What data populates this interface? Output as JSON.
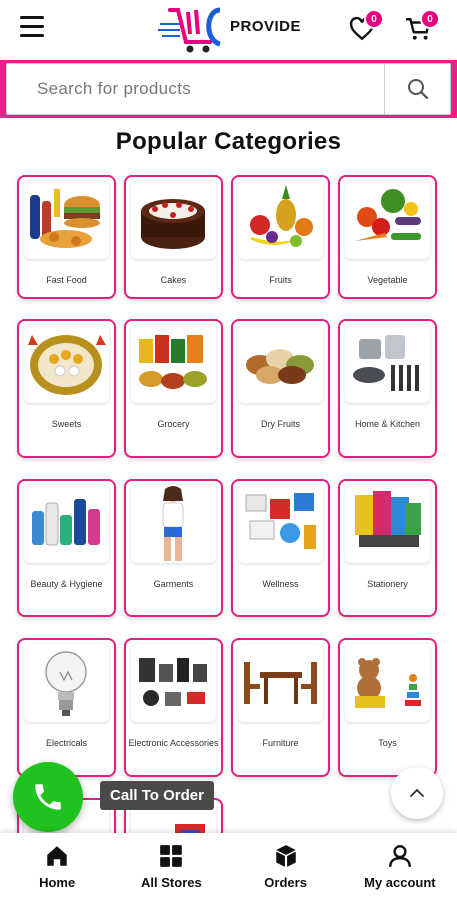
{
  "header": {
    "logo_text": "PROVIDE",
    "wishlist_count": "0",
    "cart_count": "0",
    "brand_color": "#e6007e",
    "icons": [
      "menu-icon",
      "logo-cart-icon",
      "heart-icon",
      "cart-icon"
    ]
  },
  "search": {
    "placeholder": "Search for products"
  },
  "section_title": "Popular Categories",
  "categories": [
    {
      "label": "Fast Food"
    },
    {
      "label": "Cakes"
    },
    {
      "label": "Fruits"
    },
    {
      "label": "Vegetable"
    },
    {
      "label": "Sweets"
    },
    {
      "label": "Grocery"
    },
    {
      "label": "Dry Fruits"
    },
    {
      "label": "Home & Kitchen"
    },
    {
      "label": "Beauty & Hygiene"
    },
    {
      "label": "Garments"
    },
    {
      "label": "Wellness"
    },
    {
      "label": "Stationery"
    },
    {
      "label": "Electricals"
    },
    {
      "label": "Electronic Accessories"
    },
    {
      "label": "Furniture"
    },
    {
      "label": "Toys"
    }
  ],
  "call": {
    "tooltip": "Call To Order",
    "color": "#1fc21f"
  },
  "bottom_nav": {
    "items": [
      {
        "label": "Home",
        "icon": "home-icon"
      },
      {
        "label": "All Stores",
        "icon": "grid-icon"
      },
      {
        "label": "Orders",
        "icon": "box-icon"
      },
      {
        "label": "My account",
        "icon": "user-icon"
      }
    ]
  }
}
